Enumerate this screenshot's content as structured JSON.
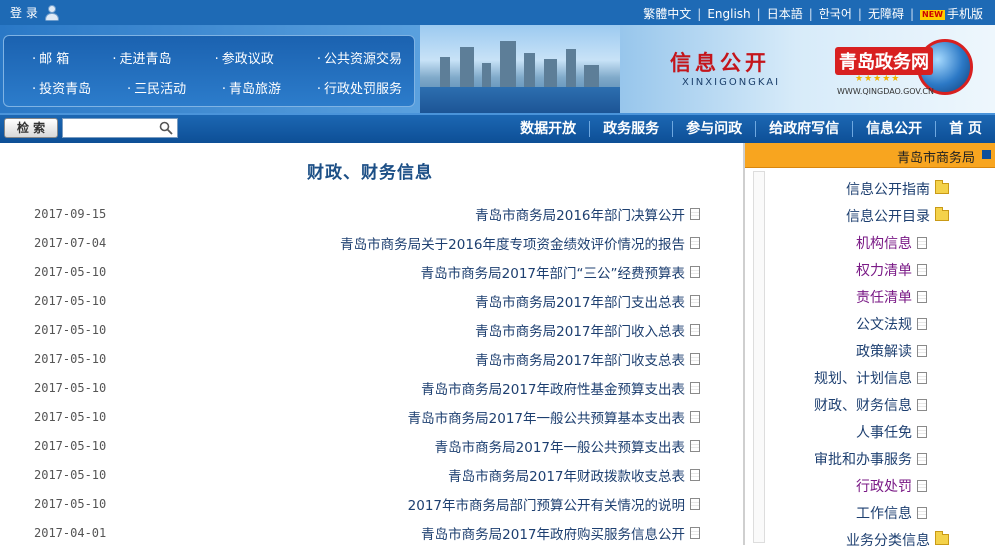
{
  "topbar": {
    "login_label": "登 录",
    "links": [
      "繁體中文",
      "English",
      "日本語",
      "한국어",
      "无障碍",
      "手机版"
    ],
    "new_badge": "NEW"
  },
  "banner": {
    "quicklinks_row1": [
      "邮 箱",
      "走进青岛",
      "参政议政",
      "公共资源交易"
    ],
    "quicklinks_row2": [
      "投资青岛",
      "三民活动",
      "青岛旅游",
      "行政处罚服务"
    ],
    "heading": "信息公开",
    "heading_pinyin": "XINXIGONGKAI",
    "logo_name": "青岛政务网",
    "logo_stars": "★★★★★",
    "logo_url": "WWW.QINGDAO.GOV.CN"
  },
  "nav": {
    "search_button": "检 索",
    "search_value": "",
    "items": [
      "首 页",
      "信息公开",
      "给政府写信",
      "参与问政",
      "政务服务",
      "数据开放"
    ]
  },
  "content": {
    "title": "财政、财务信息",
    "documents": [
      {
        "title": "青岛市商务局2016年部门决算公开",
        "date": "2017-09-15"
      },
      {
        "title": "青岛市商务局关于2016年度专项资金绩效评价情况的报告",
        "date": "2017-07-04"
      },
      {
        "title": "青岛市商务局2017年部门“三公”经费预算表",
        "date": "2017-05-10"
      },
      {
        "title": "青岛市商务局2017年部门支出总表",
        "date": "2017-05-10"
      },
      {
        "title": "青岛市商务局2017年部门收入总表",
        "date": "2017-05-10"
      },
      {
        "title": "青岛市商务局2017年部门收支总表",
        "date": "2017-05-10"
      },
      {
        "title": "青岛市商务局2017年政府性基金预算支出表",
        "date": "2017-05-10"
      },
      {
        "title": "青岛市商务局2017年一般公共预算基本支出表",
        "date": "2017-05-10"
      },
      {
        "title": "青岛市商务局2017年一般公共预算支出表",
        "date": "2017-05-10"
      },
      {
        "title": "青岛市商务局2017年财政拨款收支总表",
        "date": "2017-05-10"
      },
      {
        "title": "2017年市商务局部门预算公开有关情况的说明",
        "date": "2017-05-10"
      },
      {
        "title": "青岛市商务局2017年政府购买服务信息公开",
        "date": "2017-04-01"
      }
    ]
  },
  "sidebar": {
    "title": "青岛市商务局",
    "tree": [
      {
        "label": "信息公开指南",
        "level": 1,
        "type": "folder",
        "color": "blue"
      },
      {
        "label": "信息公开目录",
        "level": 1,
        "type": "folder",
        "color": "blue"
      },
      {
        "label": "机构信息",
        "level": 2,
        "type": "doc",
        "color": "purple"
      },
      {
        "label": "权力清单",
        "level": 2,
        "type": "doc",
        "color": "purple"
      },
      {
        "label": "责任清单",
        "level": 2,
        "type": "doc",
        "color": "purple"
      },
      {
        "label": "公文法规",
        "level": 2,
        "type": "doc",
        "color": "blue"
      },
      {
        "label": "政策解读",
        "level": 2,
        "type": "doc",
        "color": "blue"
      },
      {
        "label": "规划、计划信息",
        "level": 2,
        "type": "doc",
        "color": "blue"
      },
      {
        "label": "财政、财务信息",
        "level": 2,
        "type": "doc",
        "color": "blue"
      },
      {
        "label": "人事任免",
        "level": 2,
        "type": "doc",
        "color": "blue"
      },
      {
        "label": "审批和办事服务",
        "level": 2,
        "type": "doc",
        "color": "blue"
      },
      {
        "label": "行政处罚",
        "level": 2,
        "type": "doc",
        "color": "purple"
      },
      {
        "label": "工作信息",
        "level": 2,
        "type": "doc",
        "color": "blue"
      },
      {
        "label": "业务分类信息",
        "level": 1,
        "type": "folder",
        "color": "blue"
      }
    ]
  },
  "colors": {
    "nav_blue": "#0d4f96",
    "sidebar_header": "#f8a51f",
    "link_blue": "#1d3f70",
    "visited_purple": "#7a1a86",
    "headline_red": "#c4151b"
  }
}
